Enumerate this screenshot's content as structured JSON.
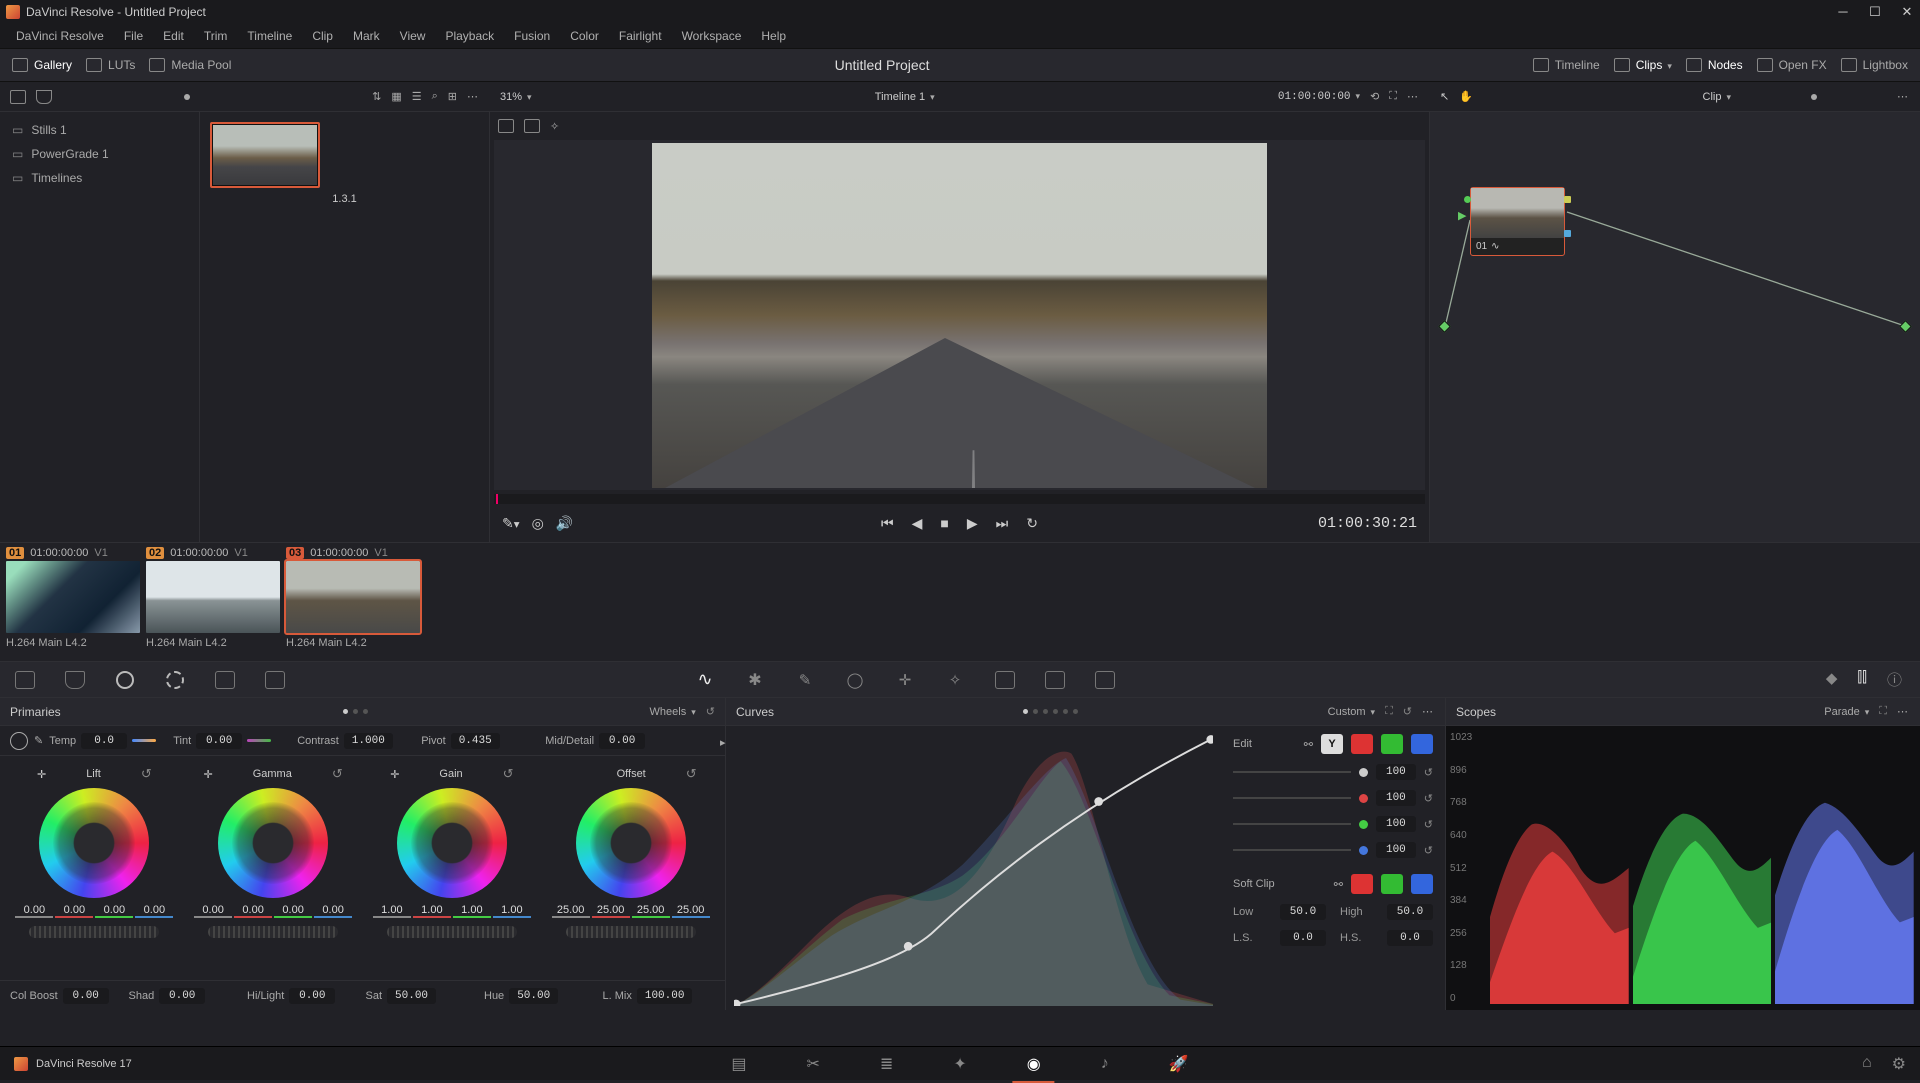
{
  "app": {
    "title": "DaVinci Resolve - Untitled Project",
    "version": "DaVinci Resolve 17"
  },
  "menu": [
    "DaVinci Resolve",
    "File",
    "Edit",
    "Trim",
    "Timeline",
    "Clip",
    "Mark",
    "View",
    "Playback",
    "Fusion",
    "Color",
    "Fairlight",
    "Workspace",
    "Help"
  ],
  "workbar": {
    "left": {
      "gallery": "Gallery",
      "luts": "LUTs",
      "mediapool": "Media Pool"
    },
    "center": "Untitled Project",
    "right": {
      "timeline": "Timeline",
      "clips": "Clips",
      "nodes": "Nodes",
      "openfx": "Open FX",
      "lightbox": "Lightbox"
    }
  },
  "gallery": {
    "items": [
      "Stills 1",
      "PowerGrade 1",
      "Timelines"
    ],
    "still_label": "1.3.1",
    "zoom": "31%",
    "timeline_name": "Timeline 1",
    "timeline_tc": "01:00:00:00",
    "node_scope": "Clip"
  },
  "viewer": {
    "tc": "01:00:30:21"
  },
  "node": {
    "label": "01"
  },
  "clips": [
    {
      "num": "01",
      "tc": "01:00:00:00",
      "track": "V1",
      "codec": "H.264 Main L4.2"
    },
    {
      "num": "02",
      "tc": "01:00:00:00",
      "track": "V1",
      "codec": "H.264 Main L4.2"
    },
    {
      "num": "03",
      "tc": "01:00:00:00",
      "track": "V1",
      "codec": "H.264 Main L4.2"
    }
  ],
  "primaries": {
    "title": "Primaries",
    "mode": "Wheels",
    "top": {
      "temp_l": "Temp",
      "temp": "0.0",
      "tint_l": "Tint",
      "tint": "0.00",
      "contrast_l": "Contrast",
      "contrast": "1.000",
      "pivot_l": "Pivot",
      "pivot": "0.435",
      "md_l": "Mid/Detail",
      "md": "0.00"
    },
    "wheels": {
      "lift": {
        "label": "Lift",
        "vals": [
          "0.00",
          "0.00",
          "0.00",
          "0.00"
        ]
      },
      "gamma": {
        "label": "Gamma",
        "vals": [
          "0.00",
          "0.00",
          "0.00",
          "0.00"
        ]
      },
      "gain": {
        "label": "Gain",
        "vals": [
          "1.00",
          "1.00",
          "1.00",
          "1.00"
        ]
      },
      "offset": {
        "label": "Offset",
        "vals": [
          "25.00",
          "25.00",
          "25.00",
          "25.00"
        ]
      }
    },
    "bottom": {
      "colboost_l": "Col Boost",
      "colboost": "0.00",
      "shad_l": "Shad",
      "shad": "0.00",
      "hl_l": "Hi/Light",
      "hl": "0.00",
      "sat_l": "Sat",
      "sat": "50.00",
      "hue_l": "Hue",
      "hue": "50.00",
      "lmix_l": "L. Mix",
      "lmix": "100.00"
    }
  },
  "curves": {
    "title": "Curves",
    "mode": "Custom",
    "edit_label": "Edit",
    "intensity": {
      "y": "100",
      "r": "100",
      "g": "100",
      "b": "100"
    },
    "softclip_label": "Soft Clip",
    "softclip": {
      "low_l": "Low",
      "low": "50.0",
      "high_l": "High",
      "high": "50.0",
      "ls_l": "L.S.",
      "ls": "0.0",
      "hs_l": "H.S.",
      "hs": "0.0"
    }
  },
  "scopes": {
    "title": "Scopes",
    "mode": "Parade",
    "scale": [
      "1023",
      "896",
      "768",
      "640",
      "512",
      "384",
      "256",
      "128",
      "0"
    ]
  }
}
